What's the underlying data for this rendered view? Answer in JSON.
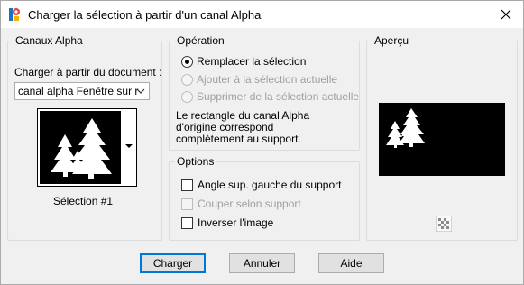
{
  "window": {
    "title": "Charger la sélection à partir d'un canal Alpha",
    "app_icon": "paintshop-icon",
    "close_icon": "close-icon"
  },
  "canaux": {
    "group_title": "Canaux Alpha",
    "load_from_label": "Charger à partir du document :",
    "document_select_value": "canal alpha Fenêtre sur r",
    "selection_label": "Sélection #1"
  },
  "operation": {
    "group_title": "Opération",
    "options": [
      {
        "label": "Remplacer la sélection",
        "checked": true,
        "enabled": true
      },
      {
        "label": "Ajouter à la sélection actuelle",
        "checked": false,
        "enabled": false
      },
      {
        "label": "Supprimer de la sélection actuelle",
        "checked": false,
        "enabled": false
      }
    ],
    "info_text_1": "Le rectangle du canal Alpha",
    "info_text_2": "d'origine correspond",
    "info_text_3": "complètement au support."
  },
  "options": {
    "group_title": "Options",
    "items": [
      {
        "label": "Angle sup. gauche du support",
        "checked": false,
        "enabled": true
      },
      {
        "label": "Couper selon support",
        "checked": false,
        "enabled": false
      },
      {
        "label": "Inverser l'image",
        "checked": false,
        "enabled": true
      }
    ]
  },
  "apercu": {
    "group_title": "Aperçu",
    "zoom_icon": "transparency-grid-icon"
  },
  "buttons": {
    "ok": "Charger",
    "cancel": "Annuler",
    "help": "Aide"
  },
  "colors": {
    "window_bg": "#f0f0f0",
    "default_button_border": "#0078d7",
    "disabled_text": "#a0a0a0"
  }
}
